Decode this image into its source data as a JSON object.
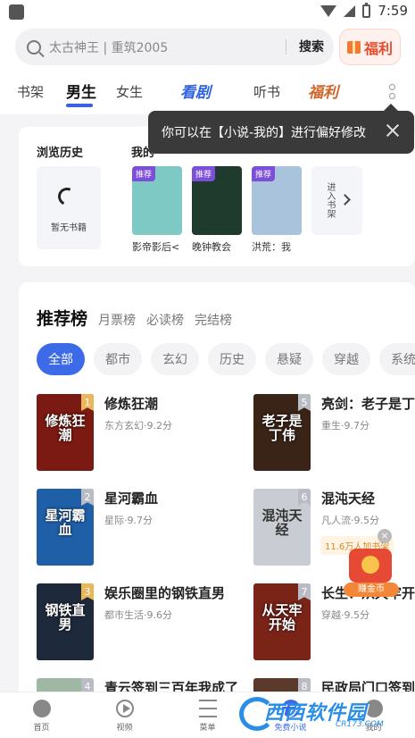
{
  "status": {
    "time": "7:59"
  },
  "search": {
    "placeholder": "太古神王 | 重筑2005",
    "button": "搜索"
  },
  "fuli_button": "福利",
  "tabs": [
    "书架",
    "男生",
    "女生",
    "看剧",
    "听书",
    "福利"
  ],
  "active_tab": "男生",
  "tooltip": {
    "text": "你可以在【小说-我的】进行偏好修改"
  },
  "history": {
    "title": "浏览历史",
    "my_title": "我的",
    "empty_text": "暂无书籍",
    "enter_shelf": "进入书架",
    "books": [
      {
        "tag": "推荐",
        "name": "影帝影后<",
        "color": "#7fc9c4"
      },
      {
        "tag": "推荐",
        "name": "晚钟教会",
        "color": "#1f3b2e"
      },
      {
        "tag": "推荐",
        "name": "洪荒：我",
        "color": "#a9c3dc"
      }
    ]
  },
  "ranking": {
    "title": "推荐榜",
    "sub_tabs": [
      "月票榜",
      "必读榜",
      "完结榜"
    ],
    "chips": [
      "全部",
      "都市",
      "玄幻",
      "历史",
      "悬疑",
      "穿越",
      "系统"
    ],
    "books": [
      {
        "rank": "1",
        "name": "修炼狂潮",
        "meta": "东方玄幻·9.2分",
        "cover_text": "修炼狂潮",
        "color": "#7a1a12"
      },
      {
        "rank": "5",
        "name": "亮剑：老子是丁伟",
        "meta": "重生·9.7分",
        "cover_text": "老子是丁伟",
        "color": "#3a2418"
      },
      {
        "rank": "2",
        "name": "星河霸血",
        "meta": "星际·9.7分",
        "cover_text": "星河霸血",
        "color": "#1f5fa8"
      },
      {
        "rank": "6",
        "name": "混沌天经",
        "meta": "凡人流·9.5分",
        "cover_text": "混沌天经",
        "color": "#c9ccd2"
      },
      {
        "rank": "3",
        "name": "娱乐圈里的钢铁直男",
        "meta": "都市生活·9.6分",
        "cover_text": "钢铁直男",
        "color": "#1e2a3c"
      },
      {
        "rank": "7",
        "name": "长生：从天牢开始",
        "meta": "穿越·9.5分",
        "cover_text": "从天牢开始",
        "color": "#7a2418"
      },
      {
        "rank": "4",
        "name": "青云签到三百年我成了",
        "meta": "",
        "cover_text": "",
        "color": "#9fb8a4"
      },
      {
        "rank": "8",
        "name": "民政局门口签到，",
        "meta": "",
        "cover_text": "",
        "color": "#5a3a2a"
      }
    ]
  },
  "coin": {
    "badge": "11.6万人加书架",
    "label": "赚金币",
    "close": "×"
  },
  "bottom_nav": [
    "首页",
    "视频",
    "菜单",
    "免费小说",
    "我的"
  ],
  "watermark": {
    "text": "西西软件园",
    "sub": "CR173.COM"
  }
}
